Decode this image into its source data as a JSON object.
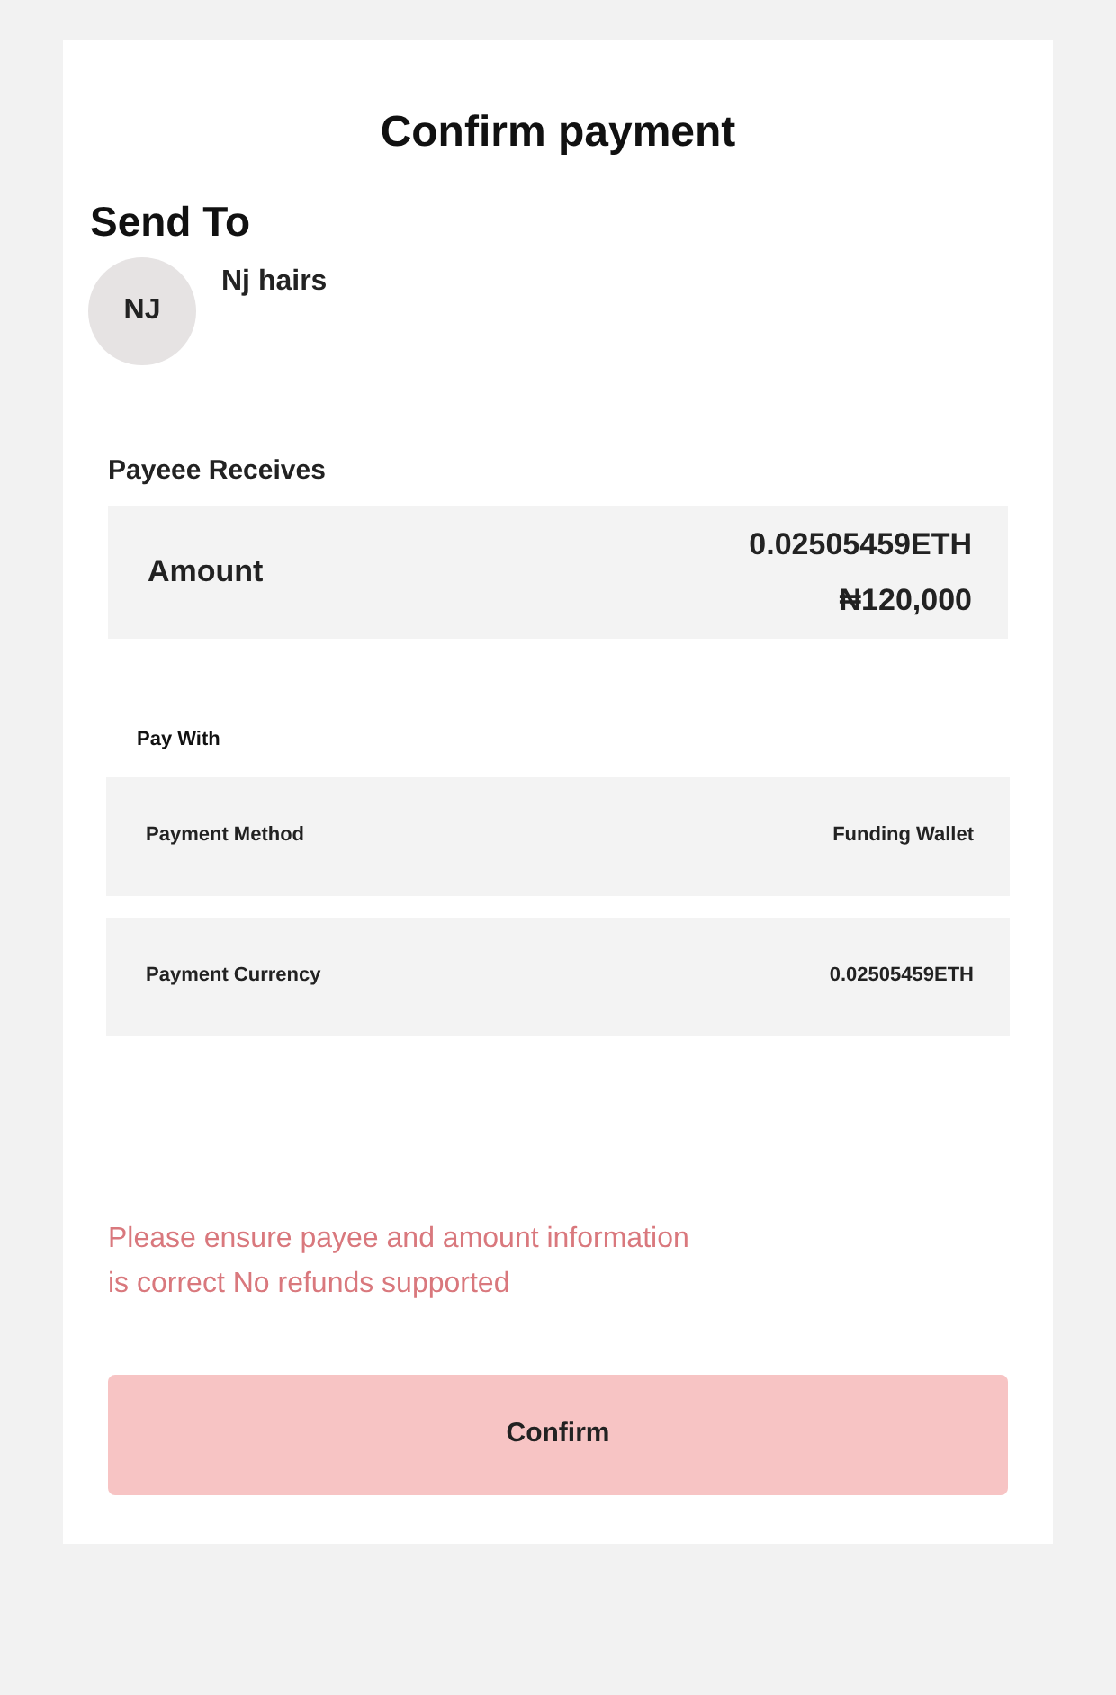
{
  "title": "Confirm payment",
  "send_to": {
    "heading": "Send To",
    "initials": "NJ",
    "name": "Nj hairs"
  },
  "payee_receives": {
    "heading": "Payeee Receives",
    "label": "Amount",
    "crypto_amount": "0.02505459ETH",
    "fiat_amount": "₦120,000"
  },
  "pay_with": {
    "heading": "Pay With",
    "rows": [
      {
        "label": "Payment Method",
        "value": "Funding Wallet"
      },
      {
        "label": "Payment Currency",
        "value": "0.02505459ETH"
      }
    ]
  },
  "notice": "Please ensure payee and amount information is correct No refunds supported",
  "confirm_button": "Confirm"
}
